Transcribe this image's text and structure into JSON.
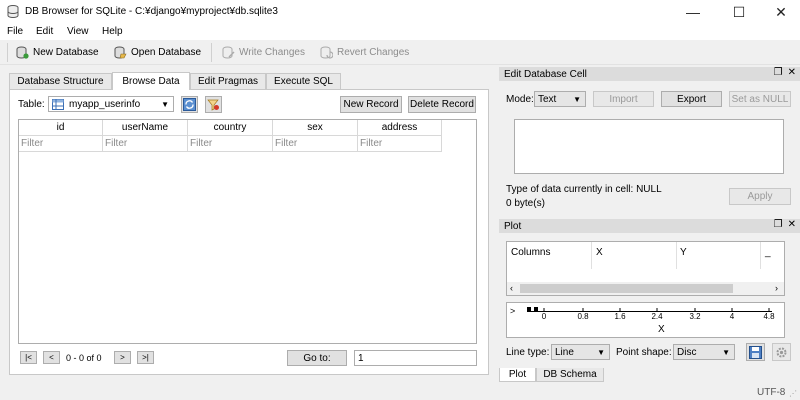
{
  "window": {
    "title": "DB Browser for SQLite - C:¥django¥myproject¥db.sqlite3",
    "min_glyph": "—",
    "max_glyph": "☐",
    "close_glyph": "✕"
  },
  "menu": [
    "File",
    "Edit",
    "View",
    "Help"
  ],
  "toolbar": {
    "new_database": "New Database",
    "open_database": "Open Database",
    "write_changes": "Write Changes",
    "revert_changes": "Revert Changes"
  },
  "tabs": [
    "Database Structure",
    "Browse Data",
    "Edit Pragmas",
    "Execute SQL"
  ],
  "browse": {
    "table_label": "Table:",
    "table_value": "myapp_userinfo",
    "new_record": "New Record",
    "delete_record": "Delete Record",
    "columns": [
      "id",
      "userName",
      "country",
      "sex",
      "address"
    ],
    "filter_placeholder": "Filter",
    "nav_first": "|<",
    "nav_prev": "<",
    "nav_next": ">",
    "nav_last": ">|",
    "record_count": "0 - 0 of 0",
    "goto_label": "Go to:",
    "goto_value": "1"
  },
  "edit_cell": {
    "title": "Edit Database Cell",
    "mode_label": "Mode:",
    "mode_value": "Text",
    "import": "Import",
    "export": "Export",
    "set_null": "Set as NULL",
    "type_info": "Type of data currently in cell: NULL",
    "size_info": "0 byte(s)",
    "apply": "Apply"
  },
  "plot": {
    "title": "Plot",
    "header_columns": "Columns",
    "header_x": "X",
    "header_y": "Y",
    "header_extra": "_",
    "axis_ticks": [
      "0",
      "0.8",
      "1.6",
      "2.4",
      "3.2",
      "4",
      "4.8"
    ],
    "axis_label": "X",
    "line_type_label": "Line type:",
    "line_type_value": "Line",
    "point_shape_label": "Point shape:",
    "point_shape_value": "Disc"
  },
  "dock_tabs": [
    "Plot",
    "DB Schema"
  ],
  "status": {
    "encoding": "UTF-8"
  },
  "colors": {
    "accent": "#2b6cb0",
    "panel_header": "#dcdcdc"
  }
}
